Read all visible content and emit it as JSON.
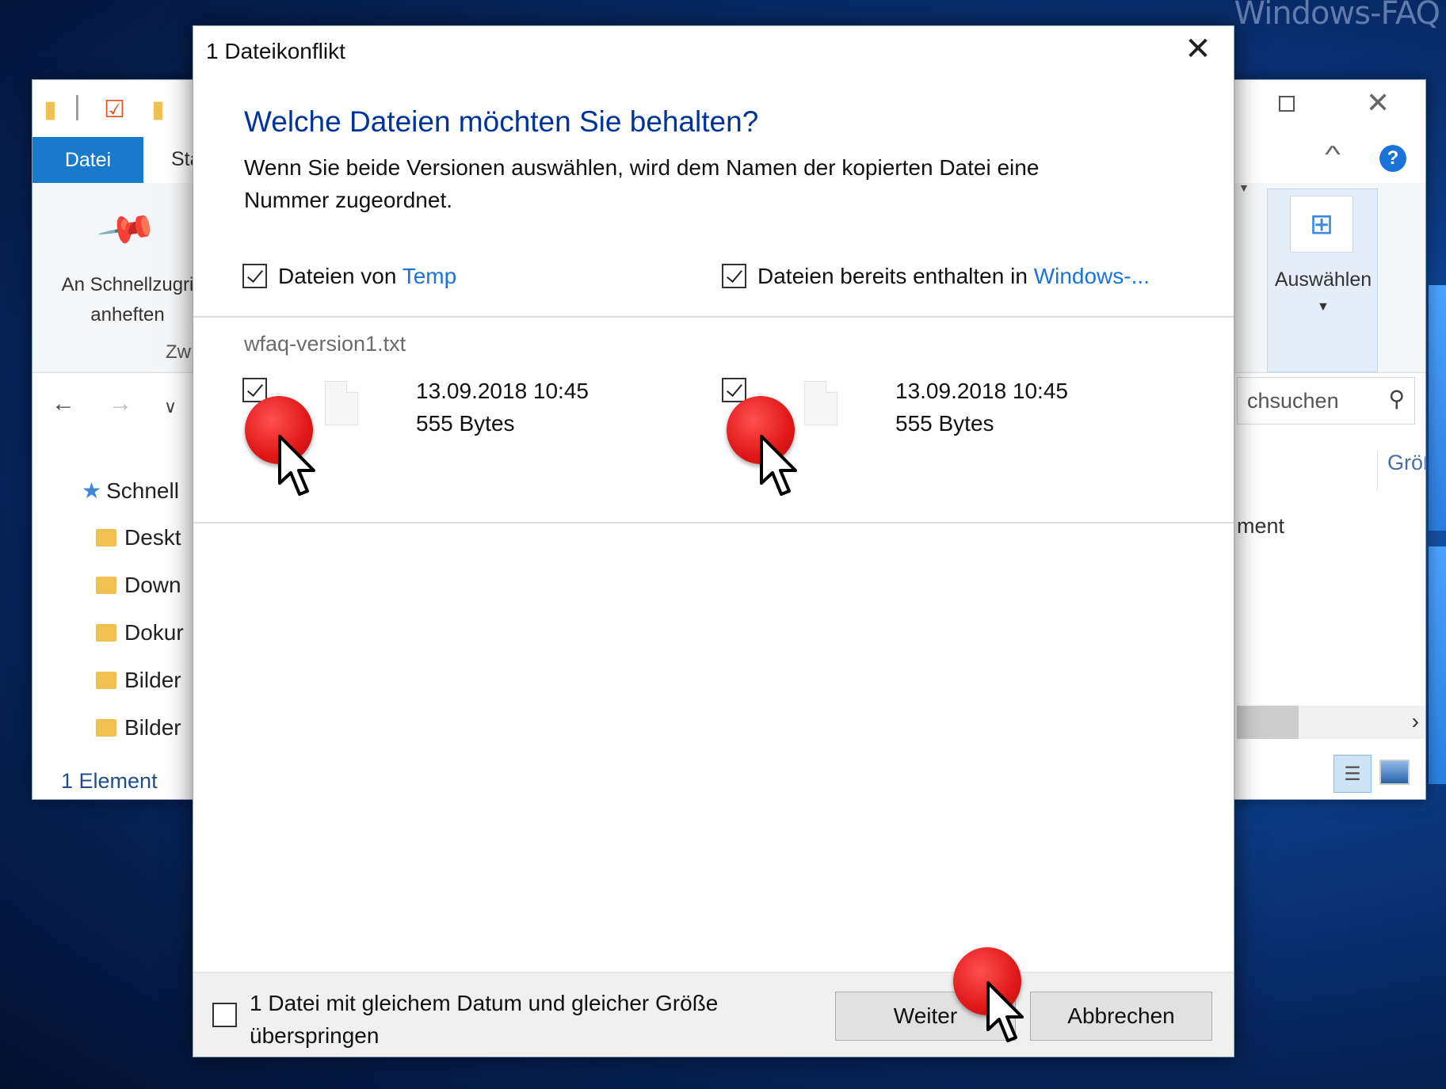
{
  "watermark": "Windows-FAQ",
  "explorer": {
    "tab_file": "Datei",
    "tab_start": "Sta",
    "pin_label": "An Schnellzugri anheften",
    "group_label": "Zw",
    "tree": [
      "Schnell",
      "Deskt",
      "Down",
      "Dokur",
      "Bilder",
      "Bilder"
    ],
    "status": "1 Element",
    "select_label": "Auswählen",
    "search_text": "chsuchen",
    "col_size": "Größ",
    "row_text": "ment"
  },
  "dialog": {
    "title": "1 Dateikonflikt",
    "heading": "Welche Dateien möchten Sie behalten?",
    "subtext": "Wenn Sie beide Versionen auswählen, wird dem Namen der kopierten Datei eine Nummer zugeordnet.",
    "source_col": {
      "prefix": "Dateien von ",
      "link": "Temp",
      "checked": true
    },
    "dest_col": {
      "prefix": "Dateien bereits enthalten in ",
      "link": "Windows-...",
      "checked": true
    },
    "file": {
      "name": "wfaq-version1.txt",
      "source": {
        "date": "13.09.2018 10:45",
        "size": "555 Bytes",
        "checked": true
      },
      "dest": {
        "date": "13.09.2018 10:45",
        "size": "555 Bytes",
        "checked": true
      }
    },
    "skip_label": "1 Datei mit gleichem Datum und gleicher Größe überspringen",
    "skip_checked": false,
    "continue_button": "Weiter",
    "cancel_button": "Abbrechen"
  },
  "colors": {
    "heading": "#003399",
    "link": "#1a73d8",
    "marker": "#e01818",
    "ribbon_tab": "#1979ca"
  }
}
